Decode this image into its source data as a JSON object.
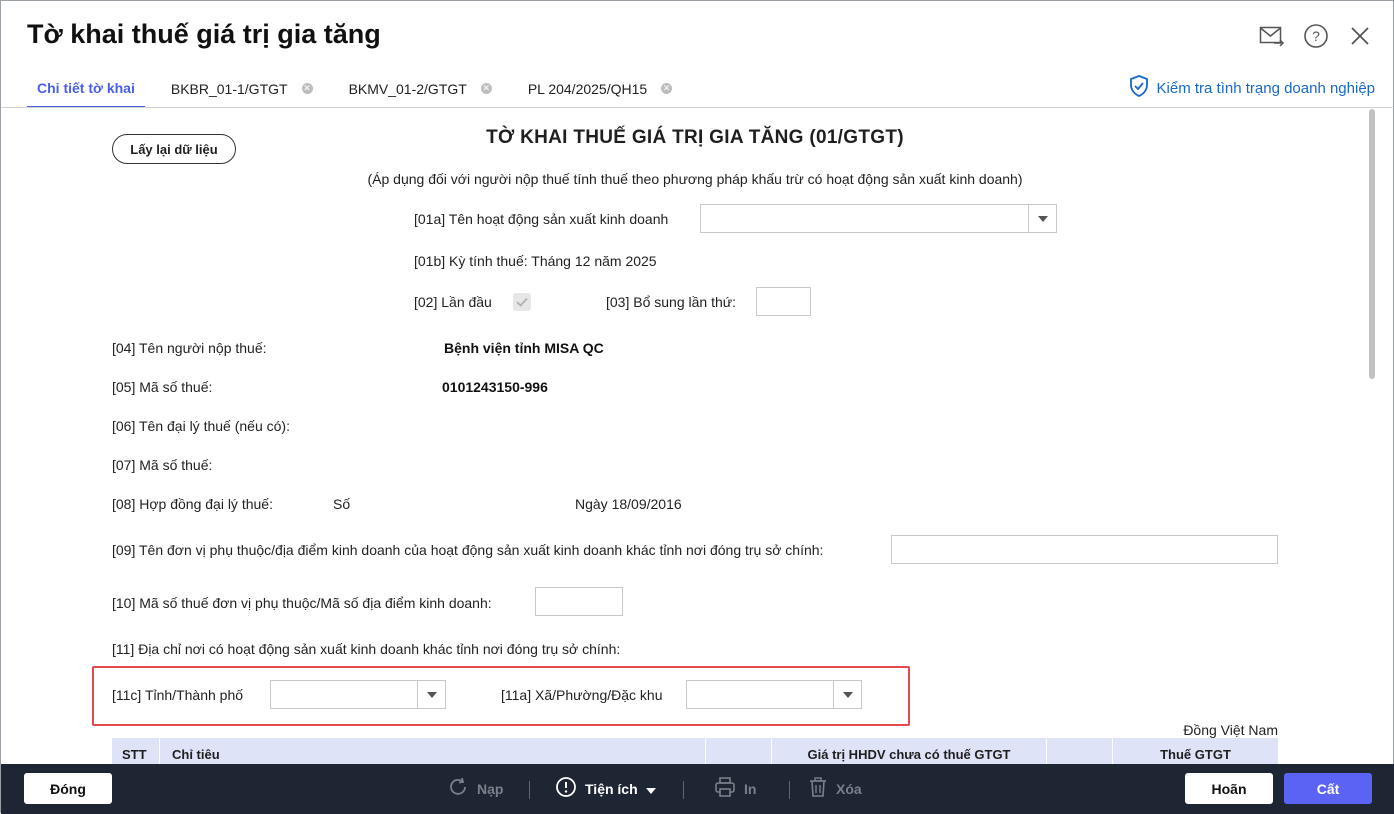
{
  "window": {
    "title": "Tờ khai thuế giá trị gia tăng",
    "icons": [
      "mail-send-icon",
      "help-icon",
      "close-icon"
    ]
  },
  "tabs": [
    {
      "label": "Chi tiết tờ khai",
      "active": true,
      "closable": false
    },
    {
      "label": "BKBR_01-1/GTGT",
      "active": false,
      "closable": true
    },
    {
      "label": "BKMV_01-2/GTGT",
      "active": false,
      "closable": true
    },
    {
      "label": "PL 204/2025/QH15",
      "active": false,
      "closable": true
    }
  ],
  "check_link": {
    "label": "Kiểm tra tình trạng doanh nghiệp",
    "icon": "shield-check-icon"
  },
  "form": {
    "reload_label": "Lấy lại dữ liệu",
    "title": "TỜ KHAI THUẾ GIÁ TRỊ GIA TĂNG (01/GTGT)",
    "subtitle": "(Áp dụng đối với người nộp thuế tính thuế theo phương pháp khấu trừ có hoạt động sản xuất kinh doanh)",
    "f01a_label": "[01a] Tên hoạt động sản xuất kinh doanh",
    "f01a_value": "",
    "f01b_label": "[01b] Kỳ tính thuế: Tháng 12 năm 2025",
    "f02_label": "[02] Lần đầu",
    "f02_checked": true,
    "f03_label": "[03] Bổ sung lần thứ:",
    "f03_value": "",
    "f04_label": "[04] Tên người nộp thuế:",
    "f04_value": "Bệnh viện tỉnh MISA QC",
    "f05_label": "[05] Mã số thuế:",
    "f05_value": "0101243150-996",
    "f06_label": "[06] Tên đại lý thuế (nếu có):",
    "f07_label": "[07] Mã số thuế:",
    "f08_label": "[08] Hợp đồng đại lý thuế:",
    "f08_so": "Số",
    "f08_ngay": "Ngày 18/09/2016",
    "f09_label": "[09] Tên đơn vị phụ thuộc/địa điểm kinh doanh của hoạt động sản xuất kinh doanh khác tỉnh nơi đóng trụ sở chính:",
    "f09_value": "",
    "f10_label": "[10] Mã số thuế đơn vị phụ thuộc/Mã số địa điểm kinh doanh:",
    "f10_value": "",
    "f11_label": "[11] Địa chỉ nơi có hoạt động sản xuất kinh doanh khác tỉnh nơi đóng trụ sở chính:",
    "f11c_label": "[11c] Tỉnh/Thành phố",
    "f11c_value": "",
    "f11a_label": "[11a] Xã/Phường/Đặc khu",
    "f11a_value": "",
    "currency_note": "Đồng Việt Nam"
  },
  "table": {
    "headers": [
      "STT",
      "Chỉ tiêu",
      "",
      "Giá trị HHDV chưa có thuế GTGT",
      "",
      "Thuế GTGT"
    ]
  },
  "footer": {
    "close_label": "Đóng",
    "load_label": "Nạp",
    "utility_label": "Tiện ích",
    "print_label": "In",
    "delete_label": "Xóa",
    "undo_label": "Hoãn",
    "save_label": "Cất"
  },
  "colors": {
    "accent": "#4a5ee8",
    "highlight": "#e54848",
    "footer_bg": "#1f2633",
    "save_bg": "#5b63f5"
  }
}
